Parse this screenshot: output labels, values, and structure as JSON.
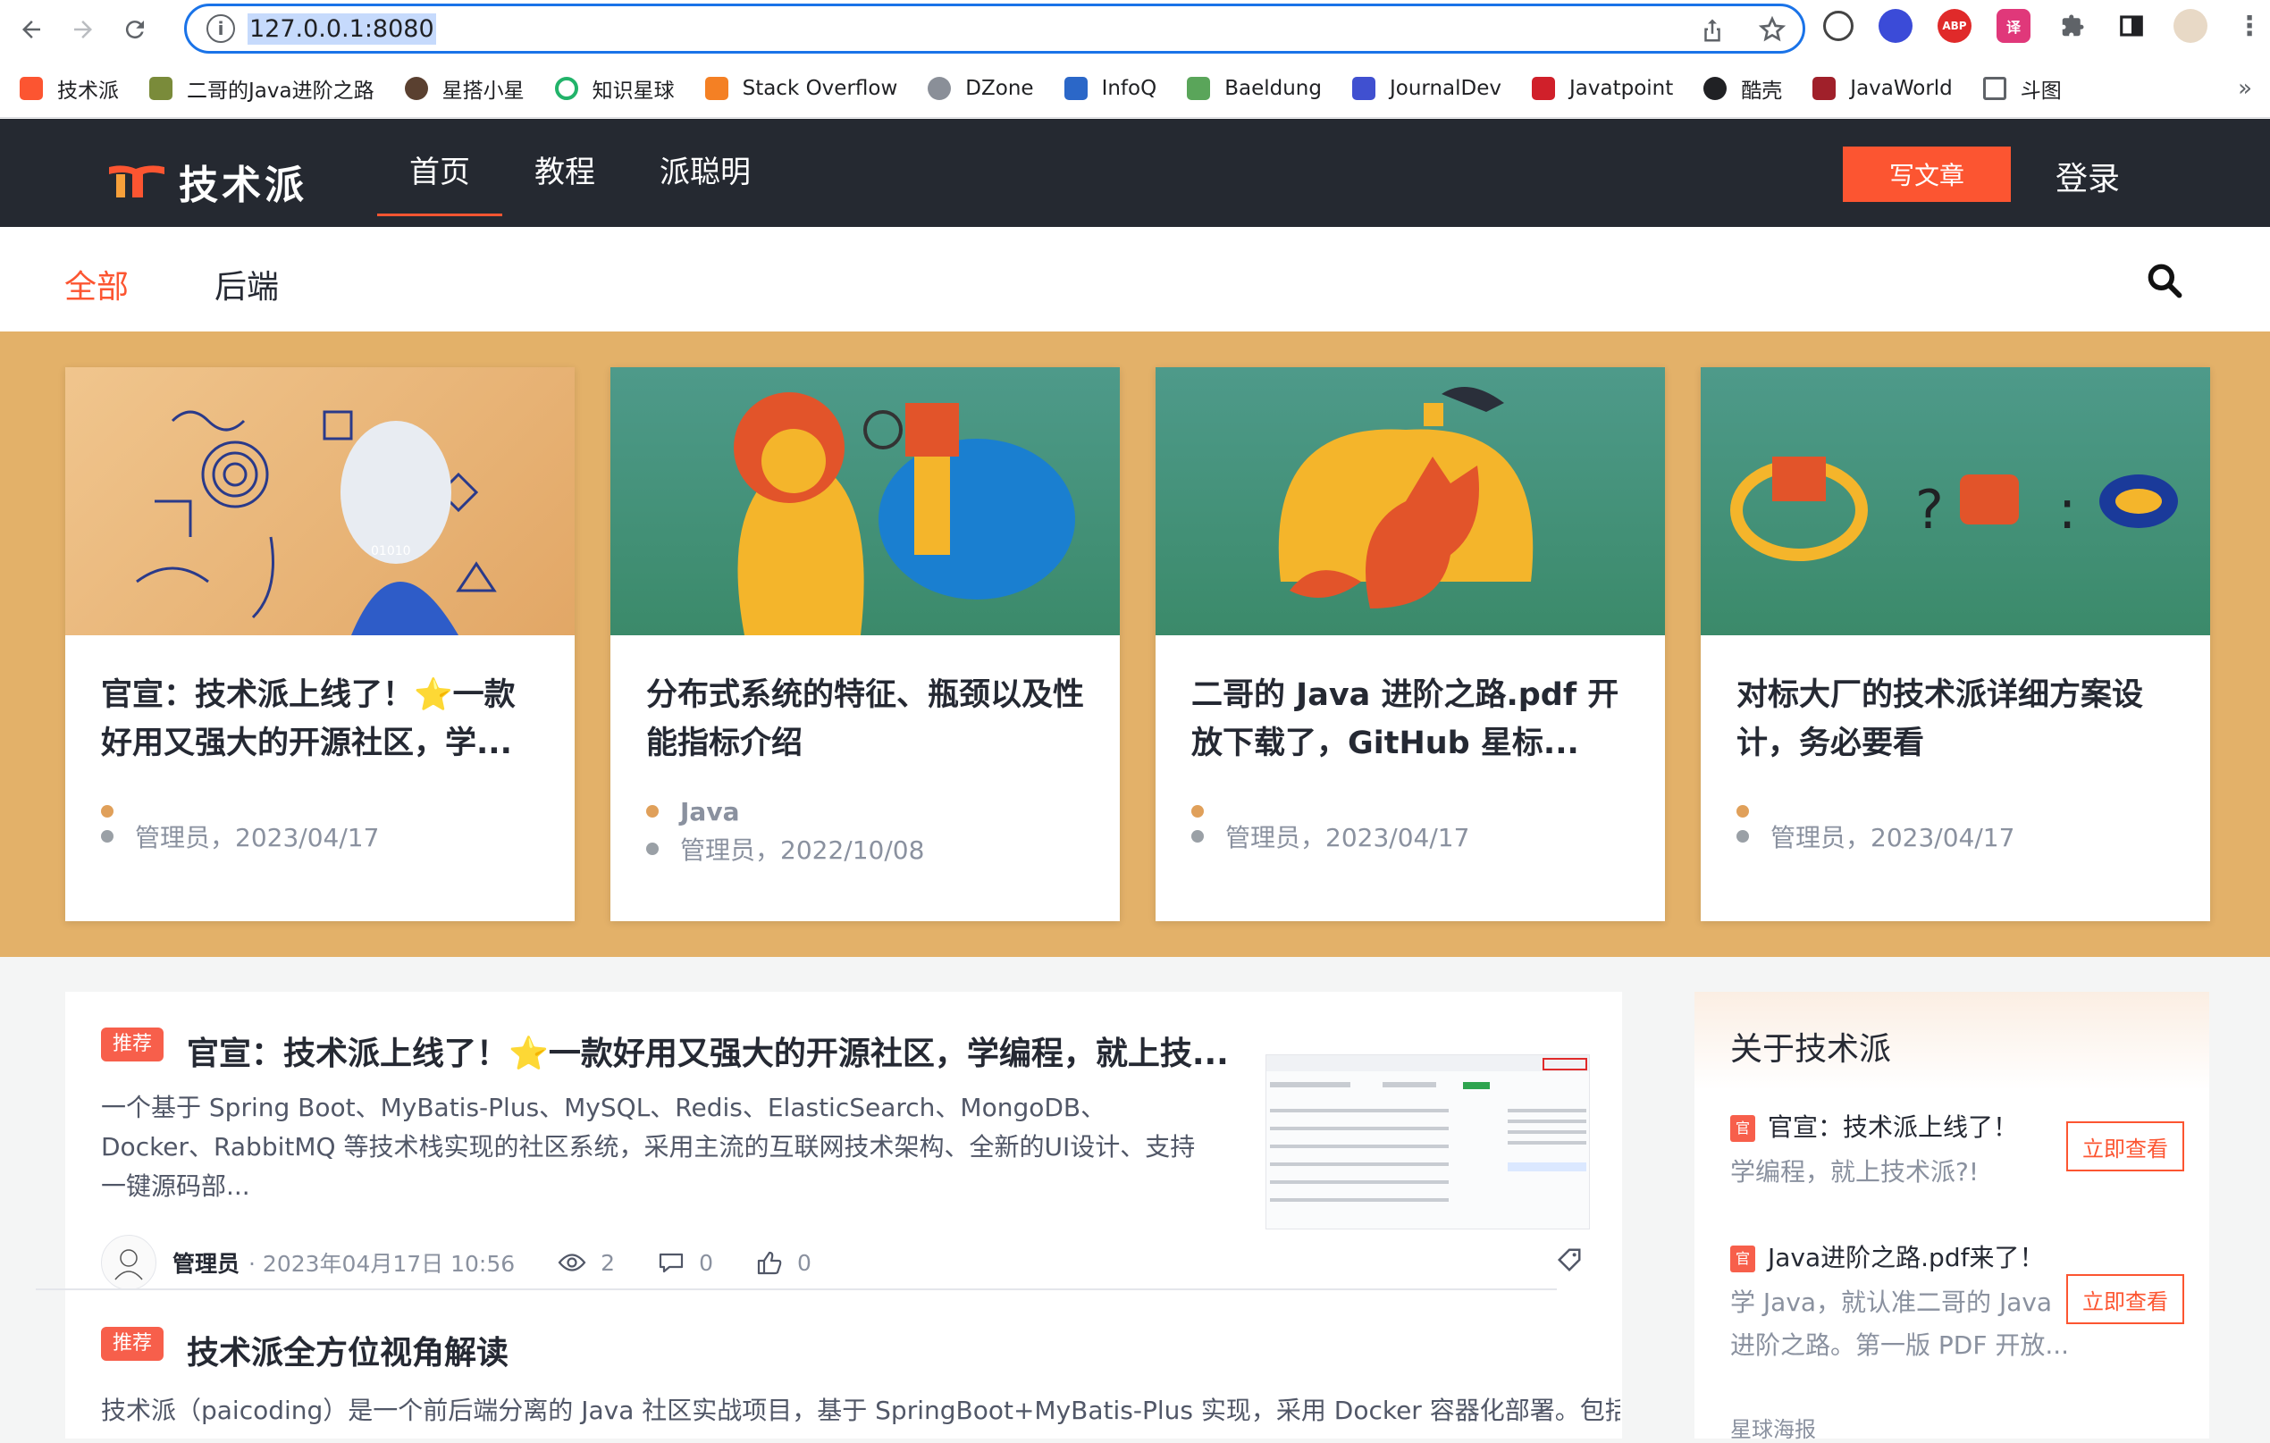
{
  "browser": {
    "url": "127.0.0.1:8080",
    "bookmarks": [
      {
        "label": "技术派",
        "color": "#fc5531"
      },
      {
        "label": "二哥的Java进阶之路",
        "color": "#7a8b3a"
      },
      {
        "label": "星搭小星",
        "color": "#5a4030"
      },
      {
        "label": "知识星球",
        "color": "#22b36a"
      },
      {
        "label": "Stack Overflow",
        "color": "#f48024"
      },
      {
        "label": "DZone",
        "color": "#8a8f98"
      },
      {
        "label": "InfoQ",
        "color": "#2b67c8"
      },
      {
        "label": "Baeldung",
        "color": "#5aa55a"
      },
      {
        "label": "JournalDev",
        "color": "#4050d0"
      },
      {
        "label": "Javatpoint",
        "color": "#d0202a"
      },
      {
        "label": "酷壳",
        "color": "#202124"
      },
      {
        "label": "JavaWorld",
        "color": "#a0202a"
      },
      {
        "label": "斗图",
        "color": "#9aa0a6"
      }
    ]
  },
  "header": {
    "logo_text": "技术派",
    "nav": [
      "首页",
      "教程",
      "派聪明"
    ],
    "write_label": "写文章",
    "login_label": "登录"
  },
  "categories": [
    "全部",
    "后端"
  ],
  "banner_cards": [
    {
      "title": "官宣：技术派上线了！⭐️一款好用又强大的开源社区，学...",
      "tag": "",
      "meta": "管理员，2023/04/17"
    },
    {
      "title": "分布式系统的特征、瓶颈以及性能指标介绍",
      "tag": "Java",
      "meta": "管理员，2022/10/08"
    },
    {
      "title": "二哥的 Java 进阶之路.pdf 开放下载了，GitHub 星标...",
      "tag": "",
      "meta": "管理员，2023/04/17"
    },
    {
      "title": "对标大厂的技术派详细方案设计，务必要看",
      "tag": "",
      "meta": "管理员，2023/04/17"
    }
  ],
  "articles": [
    {
      "badge": "推荐",
      "title": "官宣：技术派上线了！⭐️一款好用又强大的开源社区，学编程，就上技...",
      "desc": "一个基于 Spring Boot、MyBatis-Plus、MySQL、Redis、ElasticSearch、MongoDB、Docker、RabbitMQ 等技术栈实现的社区系统，采用主流的互联网技术架构、全新的UI设计、支持一键源码部...",
      "author": "管理员",
      "date": "· 2023年04月17日 10:56",
      "views": "2",
      "comments": "0",
      "likes": "0"
    },
    {
      "badge": "推荐",
      "title": "技术派全方位视角解读",
      "desc": "技术派（paicoding）是一个前后端分离的 Java 社区实战项目，基于 SpringBoot+MyBatis-Plus 实现，采用 Docker 容器化部署。包括"
    }
  ],
  "sidebar": {
    "title": "关于技术派",
    "items": [
      {
        "icon": "官",
        "head": "官宣：技术派上线了！",
        "desc": "学编程，就上技术派?!",
        "btn": "立即查看"
      },
      {
        "icon": "官",
        "head": "Java进阶之路.pdf来了！",
        "desc": "学 Java，就认准二哥的 Java 进阶之路。第一版 PDF 开放...",
        "btn": "立即查看"
      }
    ],
    "bottom_label": "星球海报"
  },
  "colors": {
    "accent": "#fc5531",
    "header_bg": "#252931",
    "banner_bg": "#e3b169"
  }
}
